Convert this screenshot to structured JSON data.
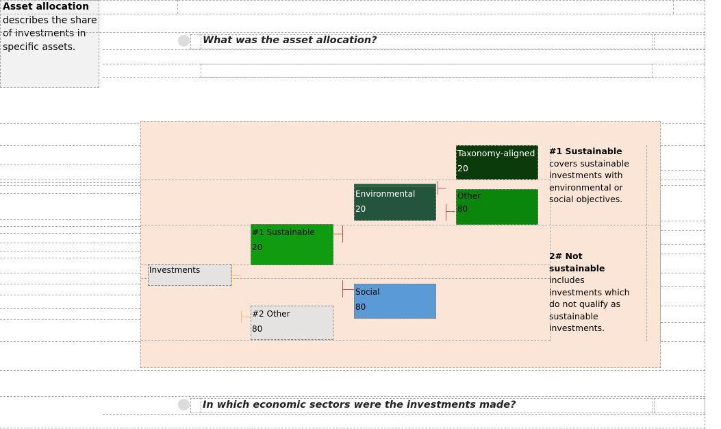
{
  "definition": {
    "term": "Asset allocation",
    "text": "describes the share of investments in specific assets."
  },
  "questions": {
    "asset_allocation": "What was the asset allocation?",
    "sectors": "In which economic sectors were the investments made?"
  },
  "diagram": {
    "investments": "Investments",
    "sustainable": {
      "label": "#1 Sustainable",
      "value": "20"
    },
    "other": {
      "label": "#2 Other",
      "value": "80"
    },
    "environmental": {
      "label": "Environmental",
      "value": "20"
    },
    "social": {
      "label": "Social",
      "value": "80"
    },
    "taxonomy_aligned": {
      "label": "Taxonomy-aligned",
      "value": "20"
    },
    "env_other": {
      "label": "Other",
      "value": "80"
    },
    "legend_sustainable": {
      "title": "#1 Sustainable",
      "text": "covers sustainable investments with environmental or social objectives."
    },
    "legend_not_sustainable": {
      "title": "2# Not sustainable",
      "text": "includes investments which do not qualify as sustainable investments."
    },
    "colors": {
      "taxonomy_aligned": "#0b3b0b",
      "env_other": "#0a870a",
      "environmental": "#23553a",
      "sustainable": "#109c10",
      "social": "#5b9bd5",
      "other": "#e5e2e2",
      "investments": "#e5e2e2",
      "background": "#fbe5d6"
    }
  }
}
